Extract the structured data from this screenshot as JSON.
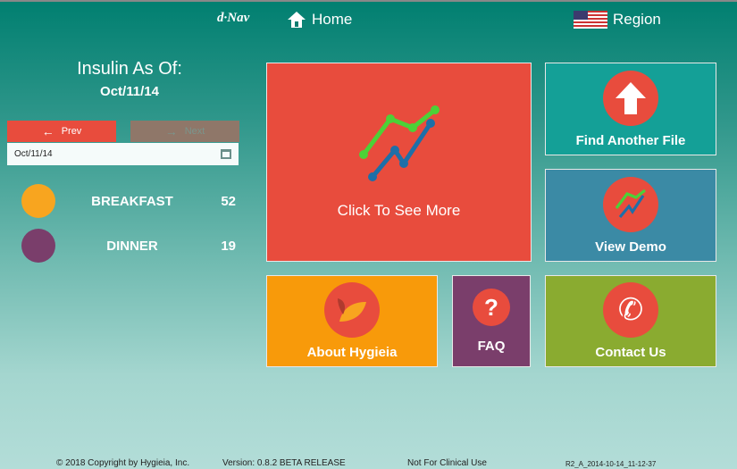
{
  "header": {
    "logo": "d·Nav",
    "home": "Home",
    "region": "Region"
  },
  "left": {
    "title": "Insulin As Of:",
    "date": "Oct/11/14",
    "prev": "Prev",
    "next": "Next",
    "date_input": "Oct/11/14",
    "meals": [
      {
        "name": "BREAKFAST",
        "value": "52"
      },
      {
        "name": "DINNER",
        "value": "19"
      }
    ]
  },
  "tiles": {
    "main": "Click To See More",
    "find": "Find Another File",
    "demo": "View Demo",
    "about": "About Hygieia",
    "faq": "FAQ",
    "contact": "Contact Us"
  },
  "footer": {
    "copyright": "© 2018 Copyright by Hygieia, Inc.",
    "version": "Version: 0.8.2 BETA RELEASE",
    "notice": "Not For Clinical Use",
    "build": "R2_A_2014-10-14_11-12-37"
  }
}
